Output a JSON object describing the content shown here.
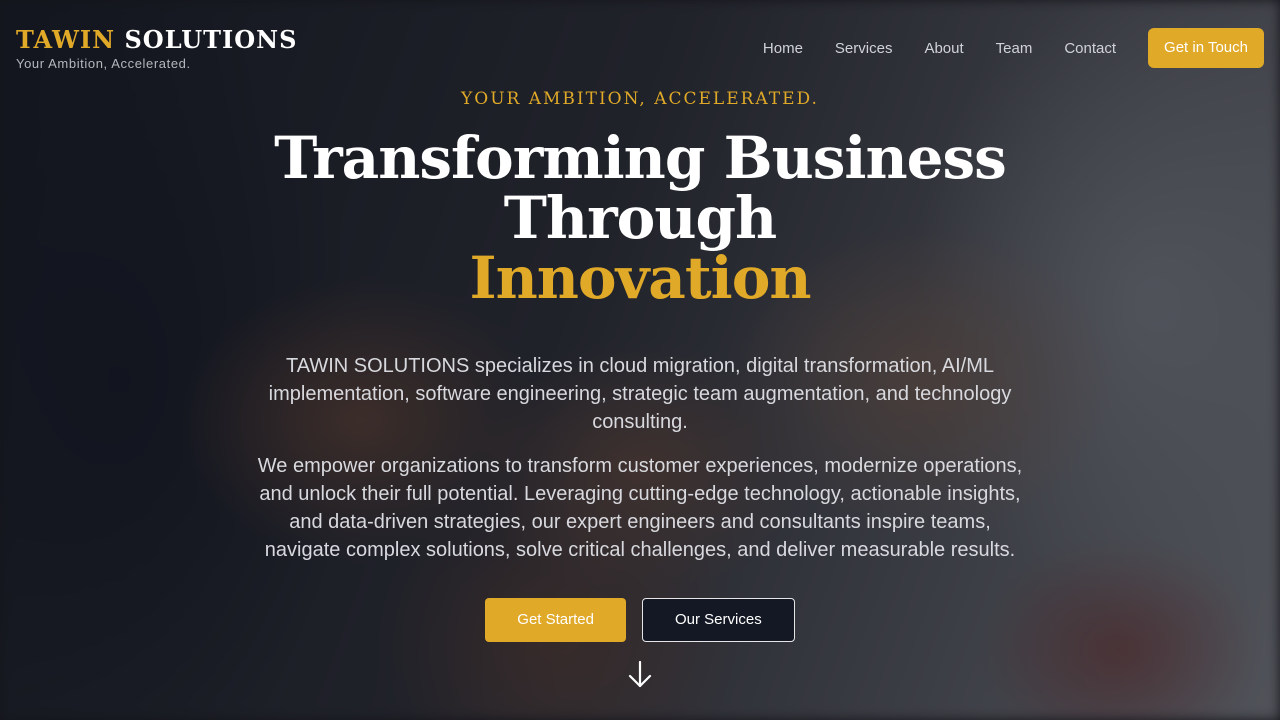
{
  "brand": {
    "title_part1": "TAWIN",
    "title_part2": "SOLUTIONS",
    "tagline": "Your Ambition, Accelerated."
  },
  "nav": {
    "links": [
      "Home",
      "Services",
      "About",
      "Team",
      "Contact"
    ],
    "cta": "Get in Touch"
  },
  "hero": {
    "eyebrow": "YOUR AMBITION, ACCELERATED.",
    "headline_line1": "Transforming Business",
    "headline_line2": "Through",
    "headline_accent": "Innovation",
    "paragraph1": "TAWIN SOLUTIONS specializes in cloud migration, digital transformation, AI/ML implementation, software engineering, strategic team augmentation, and technology consulting.",
    "paragraph2": "We empower organizations to transform customer experiences, modernize operations, and unlock their full potential. Leveraging cutting-edge technology, actionable insights, and data-driven strategies, our expert engineers and consultants inspire teams, navigate complex solutions, solve critical challenges, and deliver measurable results.",
    "primary_button": "Get Started",
    "secondary_button": "Our Services",
    "scroll_icon": "arrow-down-icon"
  },
  "colors": {
    "accent": "#e0a928",
    "overlay": "#080a10",
    "secondary_button_bg": "#141824"
  }
}
